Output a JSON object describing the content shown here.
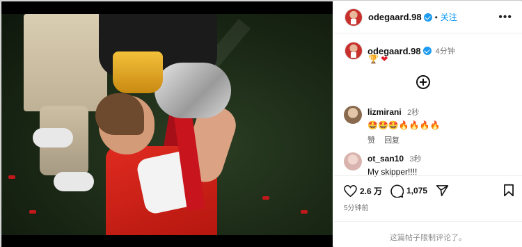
{
  "post": {
    "username": "odegaard.98",
    "follow_label": "关注",
    "more_label": "•••",
    "caption_username": "odegaard.98",
    "caption_time": "4分钟",
    "caption_emojis": [
      "🏆",
      "❤"
    ],
    "likes": "2.6 万",
    "comments_count": "1,075",
    "posted_time": "5分钟前",
    "comments_limited": "这篇帖子限制评论了。"
  },
  "comments": [
    {
      "username": "lizmirani",
      "time": "2秒",
      "text": "🤩🤩🤩🔥🔥🔥🔥",
      "like_label": "赞",
      "reply_label": "回复"
    },
    {
      "username": "ot_san10",
      "time": "3秒",
      "text": "My skipper!!!!"
    }
  ],
  "icons": {
    "verified": "verified-badge-icon",
    "add_comment": "plus-circle-icon",
    "like": "heart-icon",
    "comment": "comment-bubble-icon",
    "share": "paper-plane-icon",
    "save": "bookmark-icon"
  },
  "colors": {
    "follow": "#0095f6",
    "verified": "#1d9bf0",
    "muted": "#737373"
  }
}
